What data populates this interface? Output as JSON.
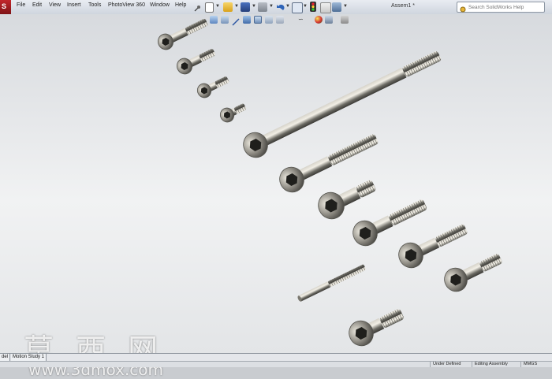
{
  "app": {
    "logo_text": "S",
    "document_title": "Assem1 *"
  },
  "menu": {
    "items": [
      "File",
      "Edit",
      "View",
      "Insert",
      "Tools",
      "PhotoView 360",
      "Window",
      "Help"
    ]
  },
  "search": {
    "placeholder": "Search SolidWorks Help"
  },
  "toolbar": {
    "icons": [
      "pin-icon",
      "new-document-icon",
      "open-folder-icon",
      "save-icon",
      "print-icon",
      "undo-icon",
      "select-icon",
      "rebuild-traffic-light-icon",
      "file-properties-icon",
      "options-icon"
    ]
  },
  "hud_toolbar": {
    "icons": [
      "zoom-to-fit-icon",
      "zoom-area-icon",
      "previous-view-icon",
      "section-view-icon",
      "view-orientation-icon",
      "display-style-icon",
      "hide-show-items-icon",
      "edit-appearance-icon",
      "apply-scene-icon",
      "view-settings-icon"
    ]
  },
  "viewport": {
    "bolts": [
      {
        "name": "bolt-small-1"
      },
      {
        "name": "bolt-small-2"
      },
      {
        "name": "bolt-small-3"
      },
      {
        "name": "bolt-small-4"
      },
      {
        "name": "bolt-long"
      },
      {
        "name": "bolt-medium-1"
      },
      {
        "name": "bolt-medium-2"
      },
      {
        "name": "bolt-medium-3"
      },
      {
        "name": "bolt-medium-4"
      },
      {
        "name": "bolt-medium-5"
      },
      {
        "name": "threaded-rod"
      },
      {
        "name": "bolt-bottom"
      }
    ],
    "watermark_cn": "莫 西 网",
    "watermark_url": "www.3dmox.com"
  },
  "tabs": {
    "items": [
      "del",
      "Motion Study 1"
    ]
  },
  "status": {
    "under_defined": "Under Defined",
    "editing": "Editing Assembly",
    "units": "MMGS"
  },
  "colors": {
    "menu_bar": "#e0e4ea",
    "logo_red": "#c2262b",
    "viewport_top": "#d7dade",
    "viewport_mid": "#f1f2f3",
    "metal_dark": "#3c3c38",
    "metal_light": "#cfccc2"
  }
}
